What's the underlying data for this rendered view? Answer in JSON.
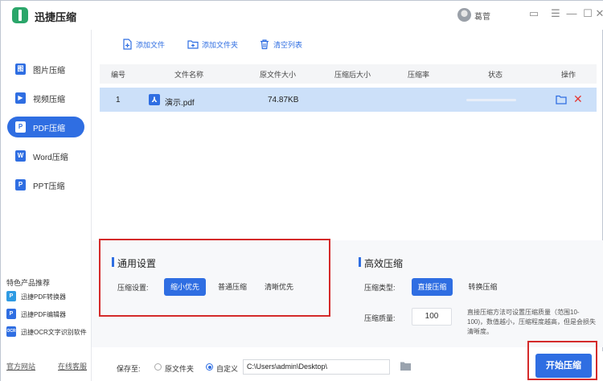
{
  "app": {
    "title": "迅捷压缩",
    "username": "葛菅"
  },
  "window_controls": {
    "feedback": "▭",
    "menu": "☰",
    "minimize": "—",
    "maximize": "☐",
    "close": "✕"
  },
  "sidebar": {
    "items": [
      {
        "label": "图片压缩",
        "icon_char": "图"
      },
      {
        "label": "视频压缩",
        "icon_char": "▶"
      },
      {
        "label": "PDF压缩",
        "icon_char": "P",
        "active": true
      },
      {
        "label": "Word压缩",
        "icon_char": "W"
      },
      {
        "label": "PPT压缩",
        "icon_char": "P"
      }
    ],
    "featured_title": "特色产品推荐",
    "featured": [
      {
        "label": "迅捷PDF转换器",
        "icon_char": "P",
        "color": "#2f9be3"
      },
      {
        "label": "迅捷PDF编辑器",
        "icon_char": "P",
        "color": "#2f6ee2"
      },
      {
        "label": "迅捷OCR文字识别软件",
        "icon_char": "OCR",
        "color": "#2f6ee2"
      }
    ],
    "footer": {
      "website": "官方网站",
      "support": "在线客服"
    }
  },
  "toolbar": {
    "add_file": "添加文件",
    "add_folder": "添加文件夹",
    "clear_list": "清空列表"
  },
  "table": {
    "headers": [
      "编号",
      "文件名称",
      "原文件大小",
      "压缩后大小",
      "压缩率",
      "状态",
      "操作"
    ],
    "rows": [
      {
        "index": "1",
        "name": "演示.pdf",
        "original_size": "74.87KB",
        "compressed_size": "",
        "ratio": "",
        "progress": 0
      }
    ]
  },
  "general_settings": {
    "title": "通用设置",
    "label": "压缩设置:",
    "options": [
      "缩小优先",
      "普通压缩",
      "清晰优先"
    ],
    "selected": "缩小优先"
  },
  "efficient": {
    "title": "高效压缩",
    "type_label": "压缩类型:",
    "type_options": [
      "直接压缩",
      "转换压缩"
    ],
    "type_selected": "直接压缩",
    "quality_label": "压缩质量:",
    "quality_value": "100",
    "hint": "直接压缩方法可设置压缩质量（范围10-100)，数值越小，压缩程度越高，但是会损失清晰度。"
  },
  "save": {
    "label": "保存至:",
    "option_original": "原文件夹",
    "option_custom": "自定义",
    "selected": "自定义",
    "path": "C:\\Users\\admin\\Desktop\\"
  },
  "start_button": "开始压缩",
  "colors": {
    "accent": "#2f6ee2",
    "row_selected": "#cce0f9",
    "highlight": "#d42a2a"
  }
}
